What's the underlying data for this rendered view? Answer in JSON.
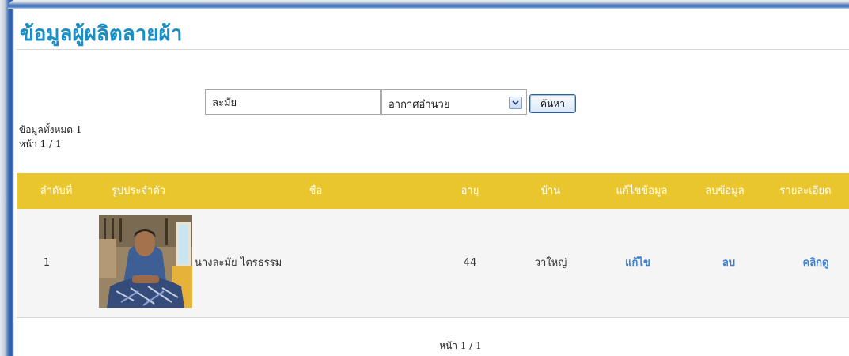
{
  "page": {
    "title": "ข้อมูลผู้ผลิตลายผ้า"
  },
  "search": {
    "keyword_value": "ละมัย",
    "district_selected": "อากาศอำนวย",
    "button_label": "ค้นหา"
  },
  "summary": {
    "total_label": "ข้อมูลทั้งหมด 1",
    "page_label": "หน้า 1 / 1"
  },
  "table": {
    "headers": {
      "index": "ลำดับที่",
      "photo": "รูปประจำตัว",
      "name": "ชื่อ",
      "age": "อายุ",
      "village": "บ้าน",
      "edit": "แก้ไขข้อมูล",
      "delete": "ลบข้อมูล",
      "detail": "รายละเอียด"
    },
    "rows": [
      {
        "index": "1",
        "name": "นางละมัย ไตรธรรม",
        "age": "44",
        "village": "วาใหญ่",
        "edit_link": "แก้ไข",
        "delete_link": "ลบ",
        "detail_link": "คลิกดู"
      }
    ]
  },
  "footer": {
    "page_label": "หน้า 1 / 1"
  },
  "colors": {
    "title": "#1a8fc6",
    "header_bg": "#e9c52e",
    "link": "#3d7fd1",
    "row_bg": "#f5f5f5"
  },
  "icons": {
    "select_arrow": "chevron-down-icon"
  }
}
